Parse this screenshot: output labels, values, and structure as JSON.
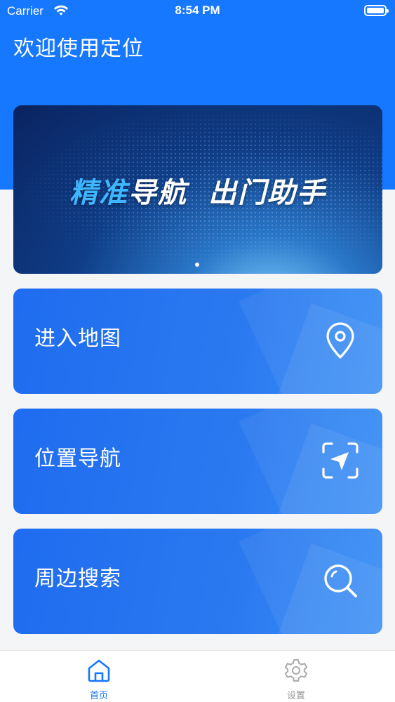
{
  "status_bar": {
    "carrier": "Carrier",
    "time": "8:54 PM"
  },
  "header": {
    "title": "欢迎使用定位"
  },
  "banner": {
    "text_accent": "精准",
    "text_rest": "导航",
    "text_second": "出门助手"
  },
  "cards": [
    {
      "label": "进入地图",
      "icon": "location-pin-icon"
    },
    {
      "label": "位置导航",
      "icon": "navigation-arrow-icon"
    },
    {
      "label": "周边搜索",
      "icon": "search-icon"
    }
  ],
  "tab_bar": {
    "items": [
      {
        "label": "首页",
        "icon": "home-icon",
        "active": true
      },
      {
        "label": "设置",
        "icon": "gear-icon",
        "active": false
      }
    ]
  },
  "colors": {
    "primary": "#1677ff",
    "inactive": "#999999",
    "card_start": "#1f6cf0",
    "card_end": "#3a8ff5"
  }
}
